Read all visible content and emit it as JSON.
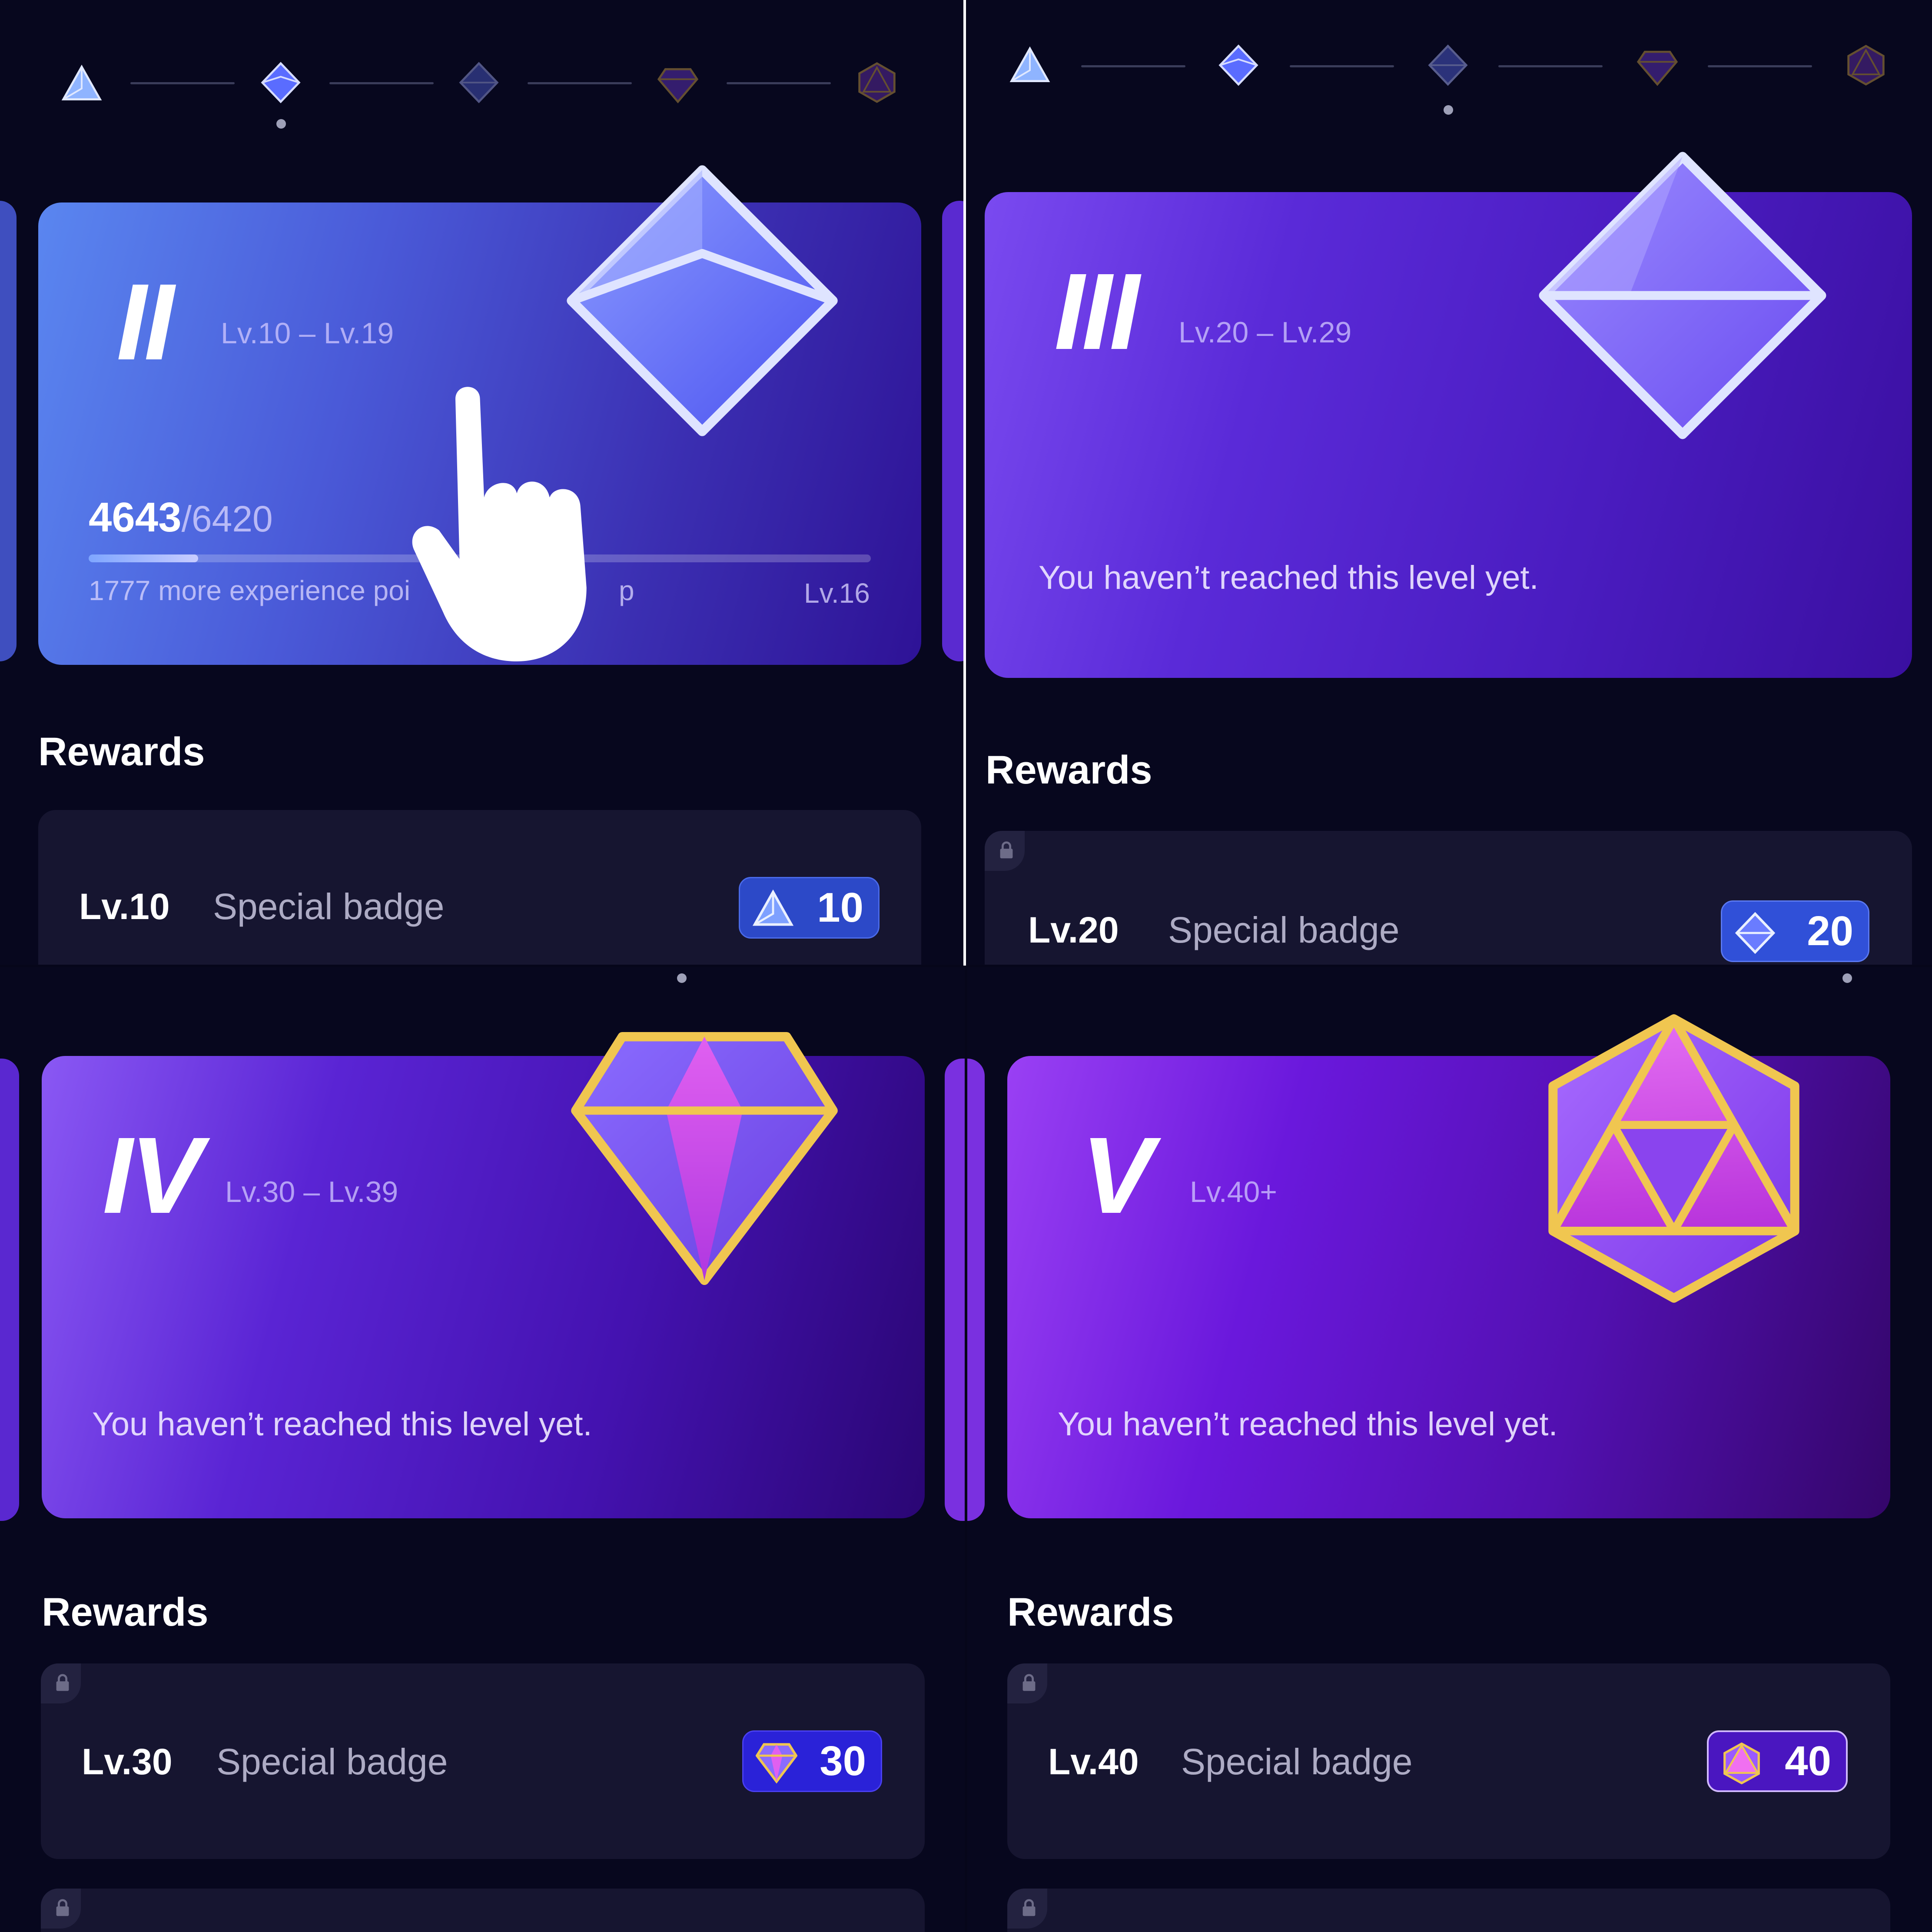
{
  "panels": [
    {
      "tier": "II",
      "range": "Lv.10 – Lv.19",
      "xp_current": "4643",
      "xp_total": "/6420",
      "progress": 0.14,
      "hint": "1777 more experience points to level up",
      "hint_visible": "1777 more experience poi",
      "hint_tail": "p",
      "current_level": "Lv.16",
      "rewards_title": "Rewards",
      "reward": {
        "level": "Lv.10",
        "label": "Special badge",
        "value": "10"
      }
    },
    {
      "tier": "III",
      "range": "Lv.20 – Lv.29",
      "message": "You haven’t reached this level yet.",
      "rewards_title": "Rewards",
      "reward": {
        "level": "Lv.20",
        "label": "Special badge",
        "value": "20"
      }
    },
    {
      "tier": "IV",
      "range": "Lv.30 – Lv.39",
      "message": "You haven’t reached this level yet.",
      "rewards_title": "Rewards",
      "reward": {
        "level": "Lv.30",
        "label": "Special badge",
        "value": "30"
      }
    },
    {
      "tier": "V",
      "range": "Lv.40+",
      "message": "You haven’t reached this level yet.",
      "rewards_title": "Rewards",
      "reward": {
        "level": "Lv.40",
        "label": "Special badge",
        "value": "40"
      }
    }
  ],
  "icons": [
    "tier-1-triangle-icon",
    "tier-2-octahedron-icon",
    "tier-3-diamond-icon",
    "tier-4-gem-icon",
    "tier-5-hexagon-icon",
    "lock-icon",
    "pointer-hand-icon"
  ],
  "colors": {
    "background": "#07071e",
    "accent_blue": "#5a6cff",
    "accent_purple": "#6a1fd8",
    "gold": "#e8c04a",
    "chip_blue": "#2c49c8",
    "chip_purple": "#4a16c0"
  }
}
